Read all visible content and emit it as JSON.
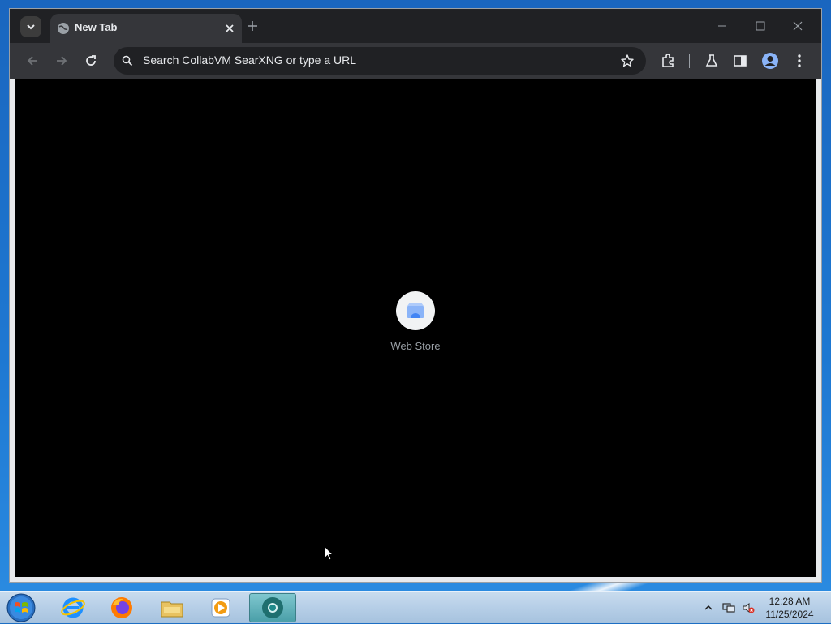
{
  "browser": {
    "tab": {
      "title": "New Tab"
    },
    "omnibox": {
      "placeholder": "Search CollabVM SearXNG or type a URL"
    },
    "shortcuts": [
      {
        "label": "Web Store"
      }
    ]
  },
  "taskbar": {
    "apps": [
      {
        "icon": "internet-explorer-icon"
      },
      {
        "icon": "firefox-icon"
      },
      {
        "icon": "file-explorer-icon"
      },
      {
        "icon": "media-player-icon"
      },
      {
        "icon": "chrome-dev-icon",
        "active": true
      }
    ],
    "clock": {
      "time": "12:28 AM",
      "date": "11/25/2024"
    }
  },
  "colors": {
    "titlebar": "#202124",
    "toolbar": "#35363a",
    "content": "#000000",
    "taskbar": "#b8d0e8"
  }
}
